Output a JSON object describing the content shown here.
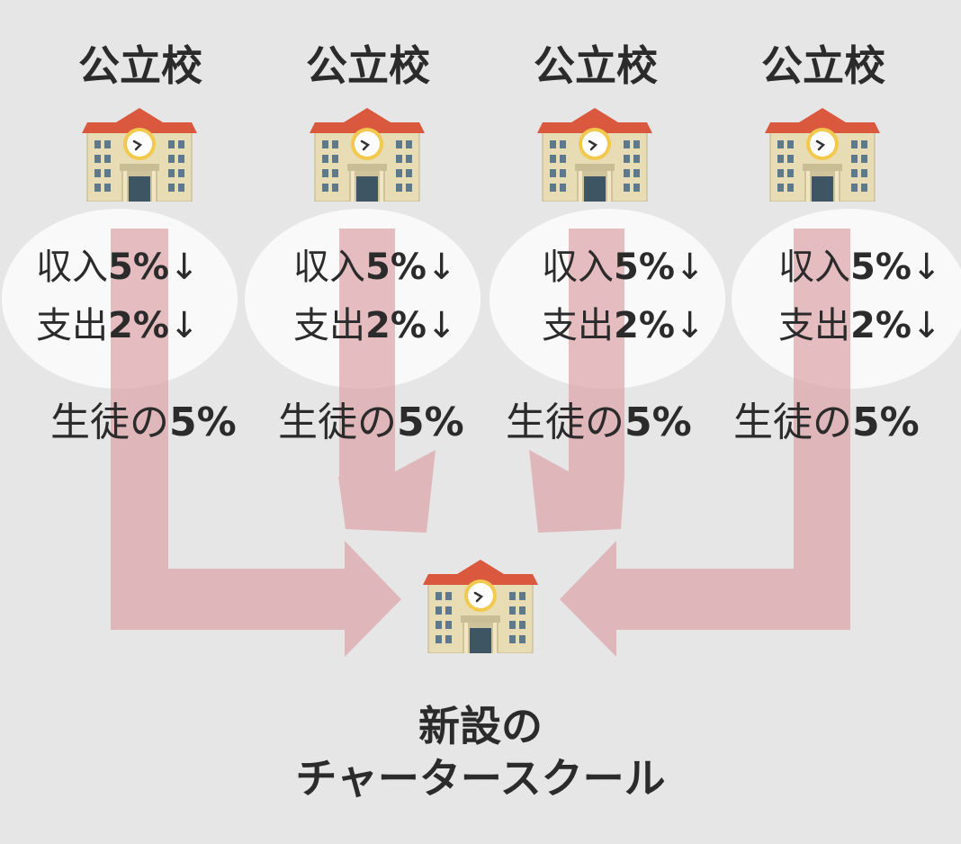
{
  "schools": [
    {
      "title": "公立校",
      "income": {
        "label": "収入",
        "value": "5%",
        "arrow": "↓"
      },
      "spending": {
        "label": "支出",
        "value": "2%",
        "arrow": "↓"
      },
      "share": {
        "label": "生徒の",
        "value": "5%"
      }
    },
    {
      "title": "公立校",
      "income": {
        "label": "収入",
        "value": "5%",
        "arrow": "↓"
      },
      "spending": {
        "label": "支出",
        "value": "2%",
        "arrow": "↓"
      },
      "share": {
        "label": "生徒の",
        "value": "5%"
      }
    },
    {
      "title": "公立校",
      "income": {
        "label": "収入",
        "value": "5%",
        "arrow": "↓"
      },
      "spending": {
        "label": "支出",
        "value": "2%",
        "arrow": "↓"
      },
      "share": {
        "label": "生徒の",
        "value": "5%"
      }
    },
    {
      "title": "公立校",
      "income": {
        "label": "収入",
        "value": "5%",
        "arrow": "↓"
      },
      "spending": {
        "label": "支出",
        "value": "2%",
        "arrow": "↓"
      },
      "share": {
        "label": "生徒の",
        "value": "5%"
      }
    }
  ],
  "target": {
    "line1": "新設の",
    "line2": "チャータースクール"
  },
  "icons": {
    "school": "school-building-icon"
  },
  "colors": {
    "background": "#e6e6e6",
    "arrow": "#dca5aa",
    "text": "#2b2b2b",
    "ellipse": "#f9f9f9",
    "roof": "#d9583e"
  }
}
